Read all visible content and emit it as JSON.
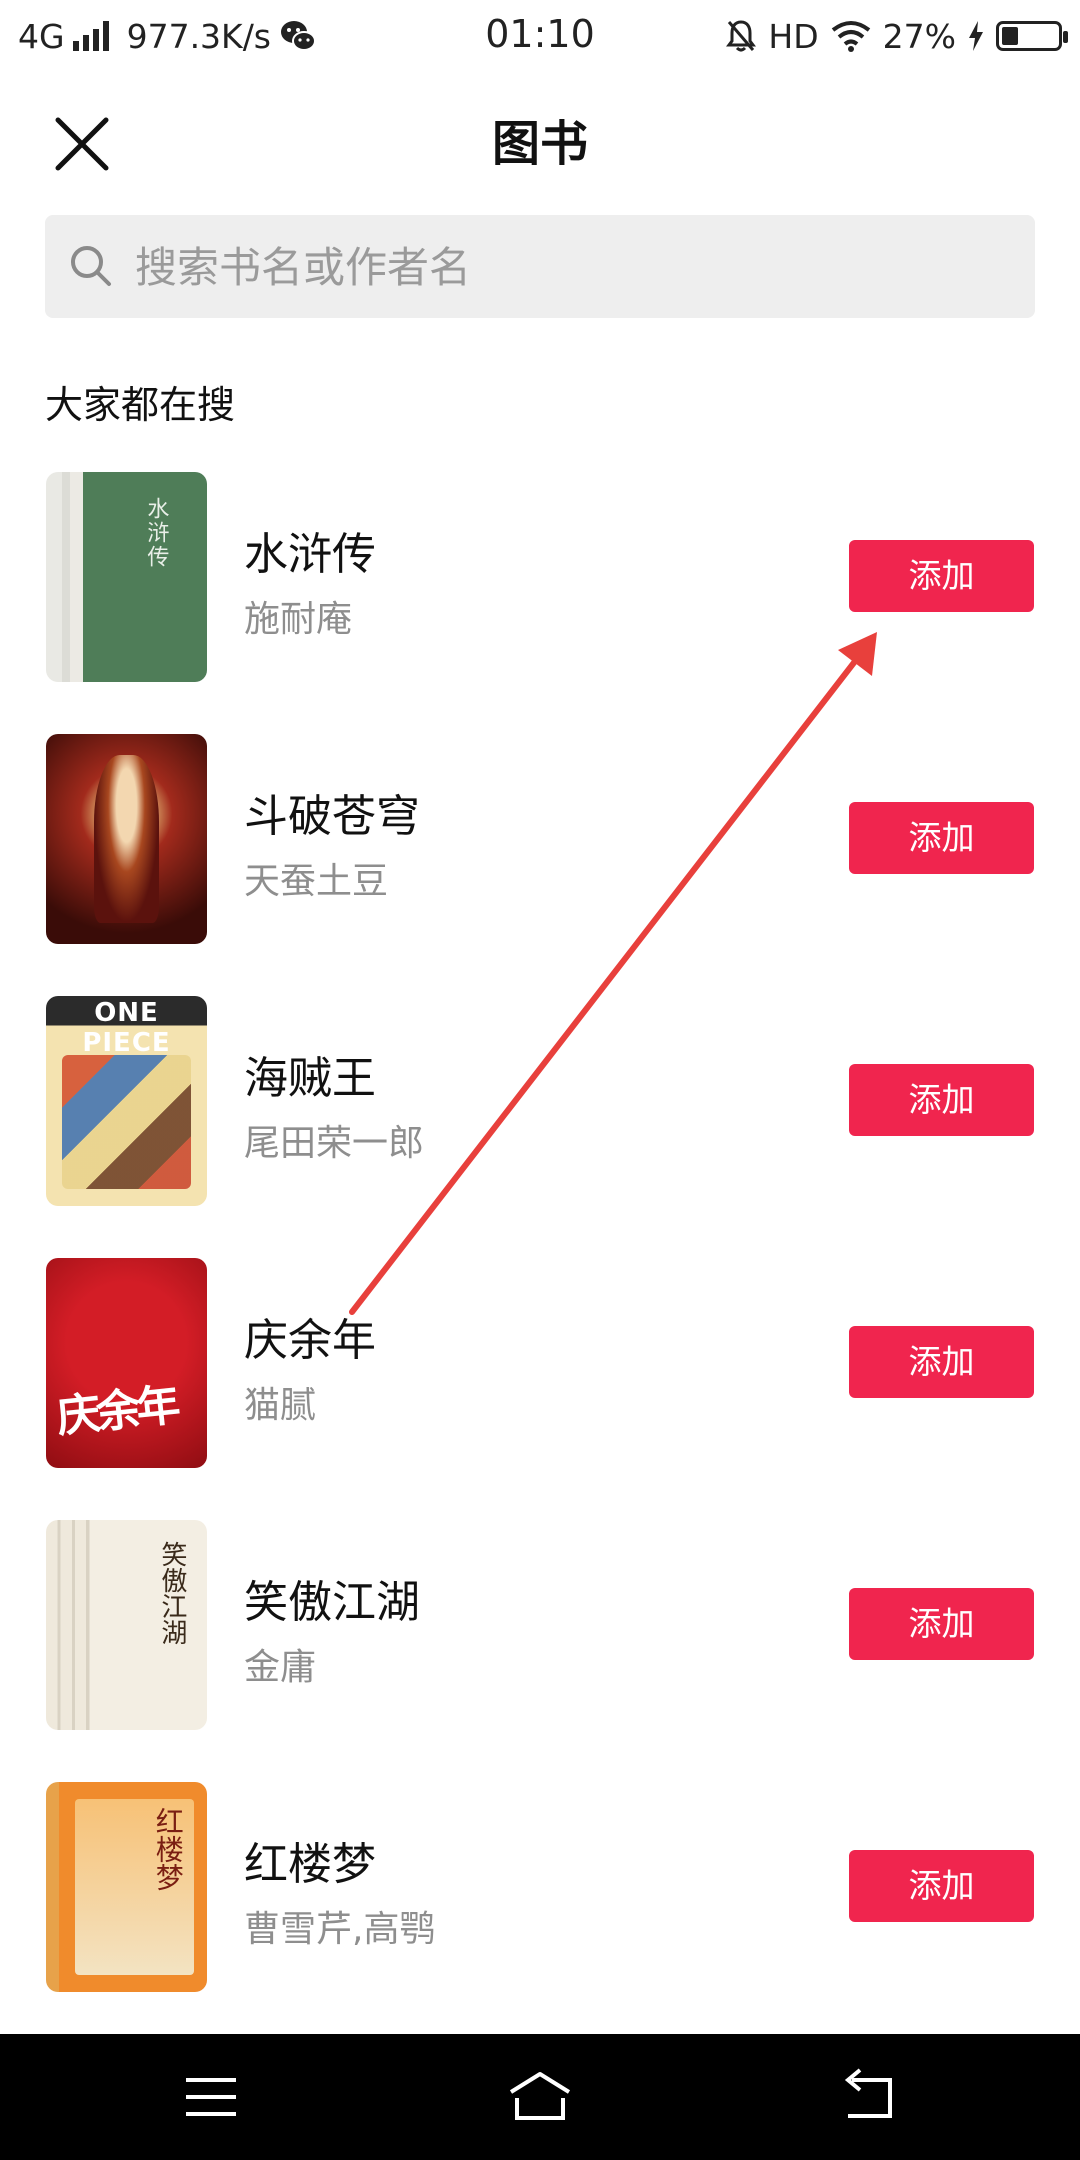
{
  "status_bar": {
    "network": "4G",
    "speed": "977.3K/s",
    "time": "01:10",
    "hd": "HD",
    "battery": "27%",
    "battery_level": 0.27
  },
  "header": {
    "title": "图书"
  },
  "search": {
    "placeholder": "搜索书名或作者名"
  },
  "section_title": "大家都在搜",
  "books": [
    {
      "title": "水浒传",
      "author": "施耐庵",
      "button": "添加",
      "cover_text": "水浒传"
    },
    {
      "title": "斗破苍穹",
      "author": "天蚕土豆",
      "button": "添加"
    },
    {
      "title": "海贼王",
      "author": "尾田荣一郎",
      "button": "添加",
      "cover_text": "ONE PIECE"
    },
    {
      "title": "庆余年",
      "author": "猫腻",
      "button": "添加",
      "cover_text": "庆余年"
    },
    {
      "title": "笑傲江湖",
      "author": "金庸",
      "button": "添加",
      "cover_text": "笑傲江湖"
    },
    {
      "title": "红楼梦",
      "author": "曹雪芹,高鹗",
      "button": "添加",
      "cover_text": "红楼梦"
    }
  ],
  "colors": {
    "accent": "#f0254e",
    "annotation_arrow": "#e8403c"
  }
}
